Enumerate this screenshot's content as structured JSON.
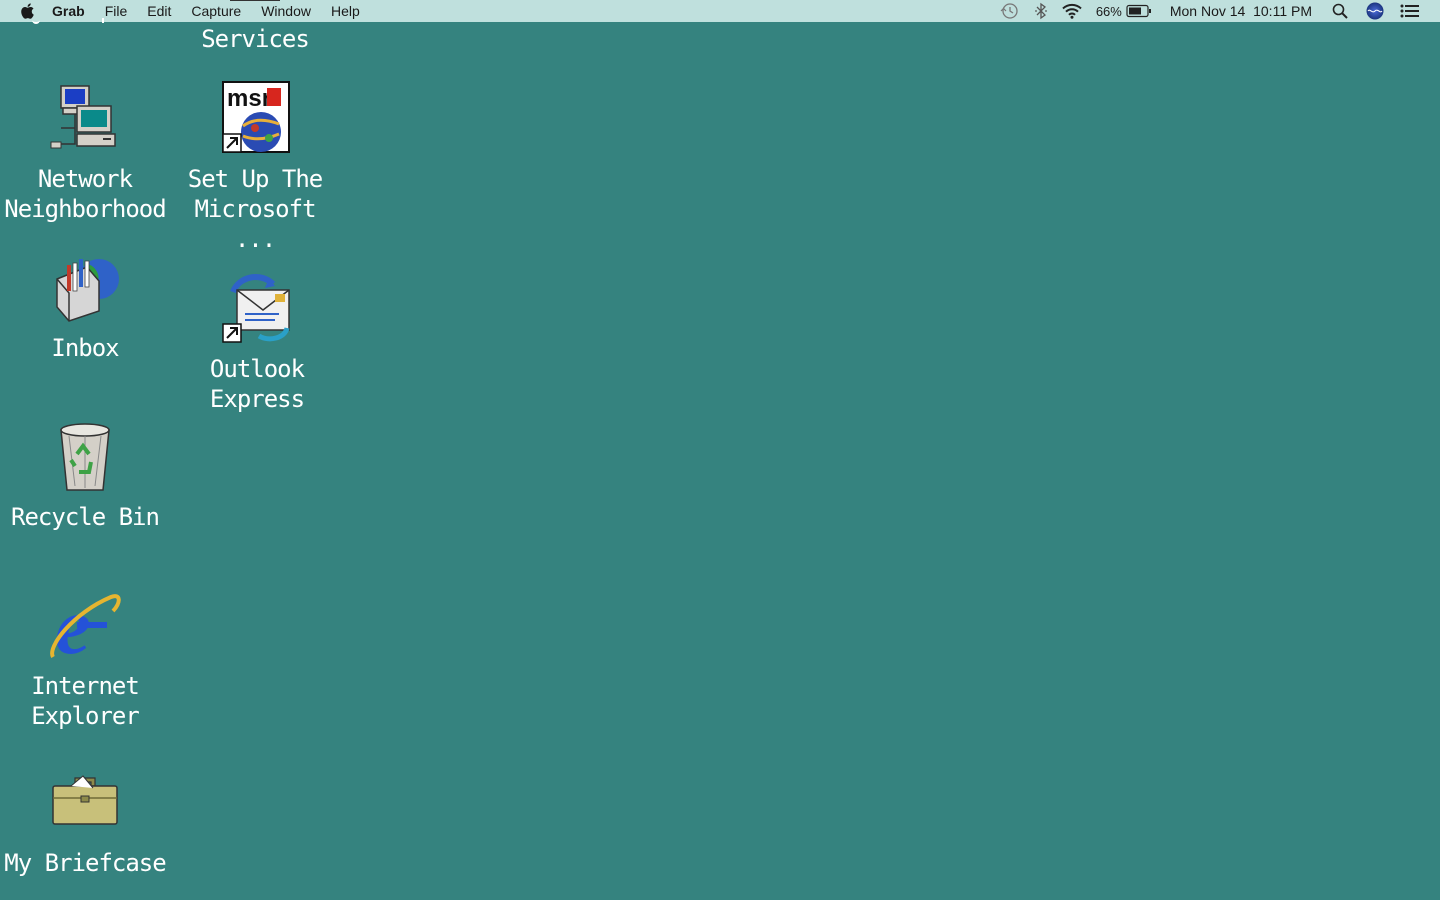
{
  "menubar": {
    "apple_icon": "apple-logo-icon",
    "app_name": "Grab",
    "items": [
      "File",
      "Edit",
      "Capture",
      "Window",
      "Help"
    ],
    "status": {
      "time_machine_icon": "time-machine-icon",
      "bluetooth_icon": "bluetooth-icon",
      "wifi_icon": "wifi-icon",
      "battery_percent": "66%",
      "battery_icon": "battery-icon",
      "datetime": "Mon Nov 14  10:11 PM",
      "spotlight_icon": "spotlight-search-icon",
      "siri_icon": "siri-icon",
      "notification_icon": "notification-center-icon"
    }
  },
  "desktop": {
    "background_color": "#35837f",
    "icons": {
      "online_services": {
        "label": "Services",
        "icon": "online-services-icon"
      },
      "network_neighborhood": {
        "label_line1": "Network",
        "label_line2": "Neighborhood",
        "icon": "network-neighborhood-icon"
      },
      "setup_msn": {
        "label_line1": "Set Up The",
        "label_line2": "Microsoft ...",
        "icon": "msn-setup-icon"
      },
      "inbox": {
        "label": "Inbox",
        "icon": "inbox-icon"
      },
      "outlook_express": {
        "label_line1": "Outlook",
        "label_line2": "Express",
        "icon": "outlook-express-icon"
      },
      "recycle_bin": {
        "label": "Recycle Bin",
        "icon": "recycle-bin-icon"
      },
      "internet_explorer": {
        "label_line1": "Internet",
        "label_line2": "Explorer",
        "icon": "internet-explorer-icon"
      },
      "my_briefcase": {
        "label": "My Briefcase",
        "icon": "briefcase-icon"
      }
    }
  }
}
